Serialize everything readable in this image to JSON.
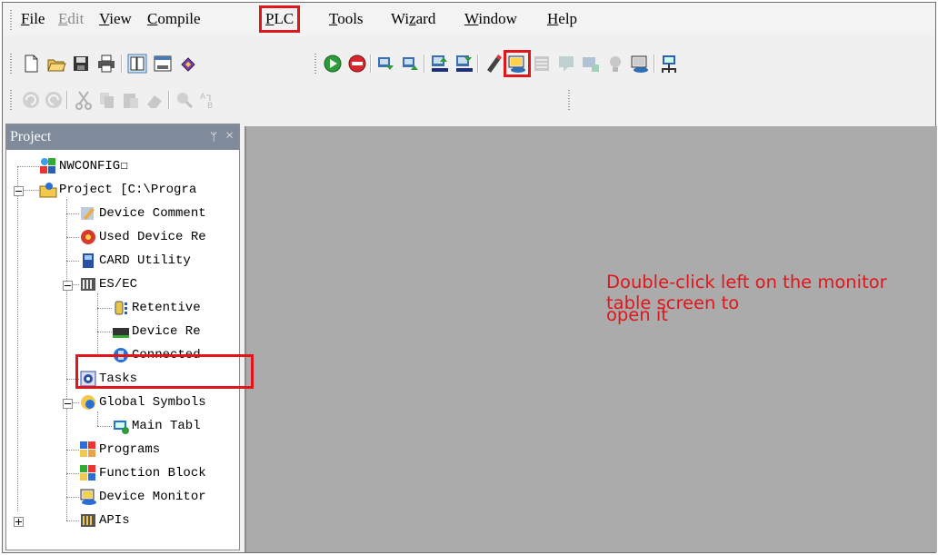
{
  "menu": [
    {
      "label": "File",
      "underline_index": 0,
      "disabled": false
    },
    {
      "label": "Edit",
      "underline_index": 0,
      "disabled": true
    },
    {
      "label": "View",
      "underline_index": 0,
      "disabled": false
    },
    {
      "label": "Compile",
      "underline_index": 0,
      "disabled": false
    },
    {
      "label": "PLC",
      "underline_index": 0,
      "disabled": false,
      "highlighted": true
    },
    {
      "label": "Tools",
      "underline_index": 0,
      "disabled": false
    },
    {
      "label": "Wizard",
      "underline_index": 2,
      "disabled": false
    },
    {
      "label": "Window",
      "underline_index": 0,
      "disabled": false
    },
    {
      "label": "Help",
      "underline_index": 0,
      "disabled": false
    }
  ],
  "toolbar1": [
    "new-file-icon",
    "open-folder-icon",
    "save-icon",
    "print-icon",
    "project-window-icon",
    "output-window-icon",
    "book-icon",
    "run-icon",
    "stop-icon",
    "upload-icon",
    "download-icon",
    "binary-upload-icon",
    "binary-download-icon",
    "online-edit-icon",
    "device-monitor-icon",
    "program-monitor-icon",
    "comment-icon",
    "memory-icon",
    "debug-icon",
    "card-icon",
    "network-icon"
  ],
  "toolbar2": [
    "undo-icon",
    "redo-icon",
    "cut-icon",
    "copy-icon",
    "paste-icon",
    "eraser-icon",
    "find-icon",
    "replace-icon"
  ],
  "highlight_color": "#e0161c",
  "project_panel": {
    "title": "Project",
    "pin_glyph": "ᛘ",
    "close_glyph": "×"
  },
  "tree": [
    {
      "label": "NWCONFIG☐",
      "icon": "nwconfig-icon"
    },
    {
      "label": "Project [C:\\Progra",
      "icon": "project-icon"
    },
    {
      "label": "Device Comment",
      "icon": "device-comment-icon"
    },
    {
      "label": "Used Device Re",
      "icon": "used-device-icon"
    },
    {
      "label": "CARD Utility",
      "icon": "card-utility-icon"
    },
    {
      "label": "ES/EC",
      "icon": "es-ec-icon"
    },
    {
      "label": "Retentive",
      "icon": "retentive-icon"
    },
    {
      "label": "Device Re",
      "icon": "device-re-icon"
    },
    {
      "label": "Connected",
      "icon": "connected-icon"
    },
    {
      "label": "Tasks",
      "icon": "tasks-icon"
    },
    {
      "label": "Global Symbols",
      "icon": "global-symbols-icon"
    },
    {
      "label": "Main Tabl",
      "icon": "main-table-icon"
    },
    {
      "label": "Programs",
      "icon": "programs-icon"
    },
    {
      "label": "Function Block",
      "icon": "function-block-icon"
    },
    {
      "label": "Device Monitor",
      "icon": "device-monitor-tree-icon",
      "highlighted": true
    },
    {
      "label": "APIs",
      "icon": "apis-icon"
    }
  ],
  "note": {
    "line1": "Double-click left on the monitor table screen to",
    "line2": "open it"
  }
}
